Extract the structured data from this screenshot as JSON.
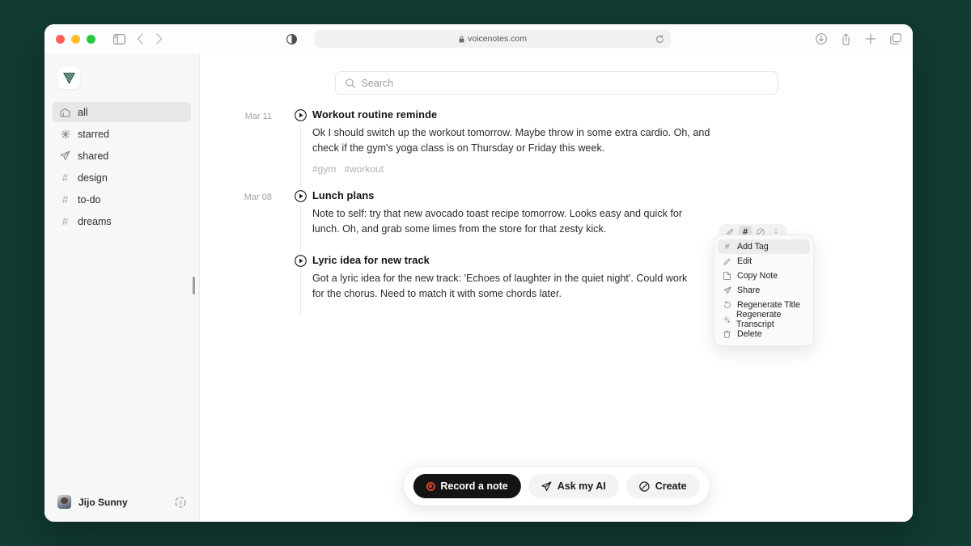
{
  "browser": {
    "url": "voicenotes.com",
    "lock_icon": "lock-icon",
    "icons": {
      "sidebar_toggle": "sidebar-toggle-icon",
      "back": "back-arrow-icon",
      "forward": "forward-arrow-icon",
      "contrast": "contrast-icon",
      "reload": "reload-icon",
      "download": "download-icon",
      "share": "share-icon",
      "new_tab": "plus-icon",
      "tab_overview": "tabs-overview-icon"
    }
  },
  "sidebar": {
    "logo": "voicenotes-logo",
    "items": [
      {
        "label": "all",
        "icon": "home-icon",
        "active": true
      },
      {
        "label": "starred",
        "icon": "sparkle-icon",
        "active": false
      },
      {
        "label": "shared",
        "icon": "paper-plane-icon",
        "active": false
      },
      {
        "label": "design",
        "icon": "hash-icon",
        "active": false
      },
      {
        "label": "to-do",
        "icon": "hash-icon",
        "active": false
      },
      {
        "label": "dreams",
        "icon": "hash-icon",
        "active": false
      }
    ],
    "user": {
      "name": "Jijo Sunny",
      "avatar": "user-avatar",
      "credits_icon": "usage-meter-icon"
    }
  },
  "search": {
    "placeholder": "Search",
    "icon": "search-icon"
  },
  "notes": [
    {
      "date": "Mar 11",
      "title": "Workout routine reminde",
      "text": "Ok I should switch up the workout tomorrow. Maybe throw in some extra cardio. Oh, and check if the gym's yoga class is on Thursday or Friday this week.",
      "tags": [
        "#gym",
        "#workout"
      ]
    },
    {
      "date": "Mar 08",
      "title": "Lunch plans",
      "text": "Note to self: try that new avocado toast recipe tomorrow. Looks easy and quick for lunch. Oh, and grab some limes from the store for that zesty kick.",
      "tags": []
    },
    {
      "date": "",
      "title": "Lyric idea for new track",
      "text": "Got a lyric idea for the new track: 'Echoes of laughter in the quiet night'. Could work for the chorus. Need to match it with some chords later.",
      "tags": []
    }
  ],
  "hover_toolbar": {
    "buttons": [
      {
        "name": "edit",
        "icon": "pencil-icon",
        "glyph": "✎",
        "active": false
      },
      {
        "name": "add-tag",
        "icon": "hash-icon",
        "glyph": "#",
        "active": true
      },
      {
        "name": "hide",
        "icon": "circle-slash-icon",
        "glyph": "⊘",
        "active": false
      },
      {
        "name": "more",
        "icon": "more-vertical-icon",
        "glyph": "⋮",
        "active": false
      }
    ]
  },
  "context_menu": {
    "items": [
      {
        "label": "Add Tag",
        "icon": "hash-icon",
        "highlighted": true
      },
      {
        "label": "Edit",
        "icon": "pencil-icon",
        "highlighted": false
      },
      {
        "label": "Copy Note",
        "icon": "document-icon",
        "highlighted": false
      },
      {
        "label": "Share",
        "icon": "paper-plane-icon",
        "highlighted": false
      },
      {
        "label": "Regenerate Title",
        "icon": "refresh-icon",
        "highlighted": false
      },
      {
        "label": "Regenerate Transcript",
        "icon": "sparkle-icon",
        "highlighted": false
      },
      {
        "label": "Delete",
        "icon": "trash-icon",
        "highlighted": false
      }
    ]
  },
  "action_bar": {
    "record": {
      "label": "Record a note",
      "icon": "record-icon"
    },
    "ask_ai": {
      "label": "Ask my AI",
      "icon": "paper-plane-icon"
    },
    "create": {
      "label": "Create",
      "icon": "circle-slash-icon"
    }
  },
  "colors": {
    "desktop_background": "#113b33",
    "accent_record": "#e23b2e",
    "sidebar_background": "#f7f7f7"
  }
}
